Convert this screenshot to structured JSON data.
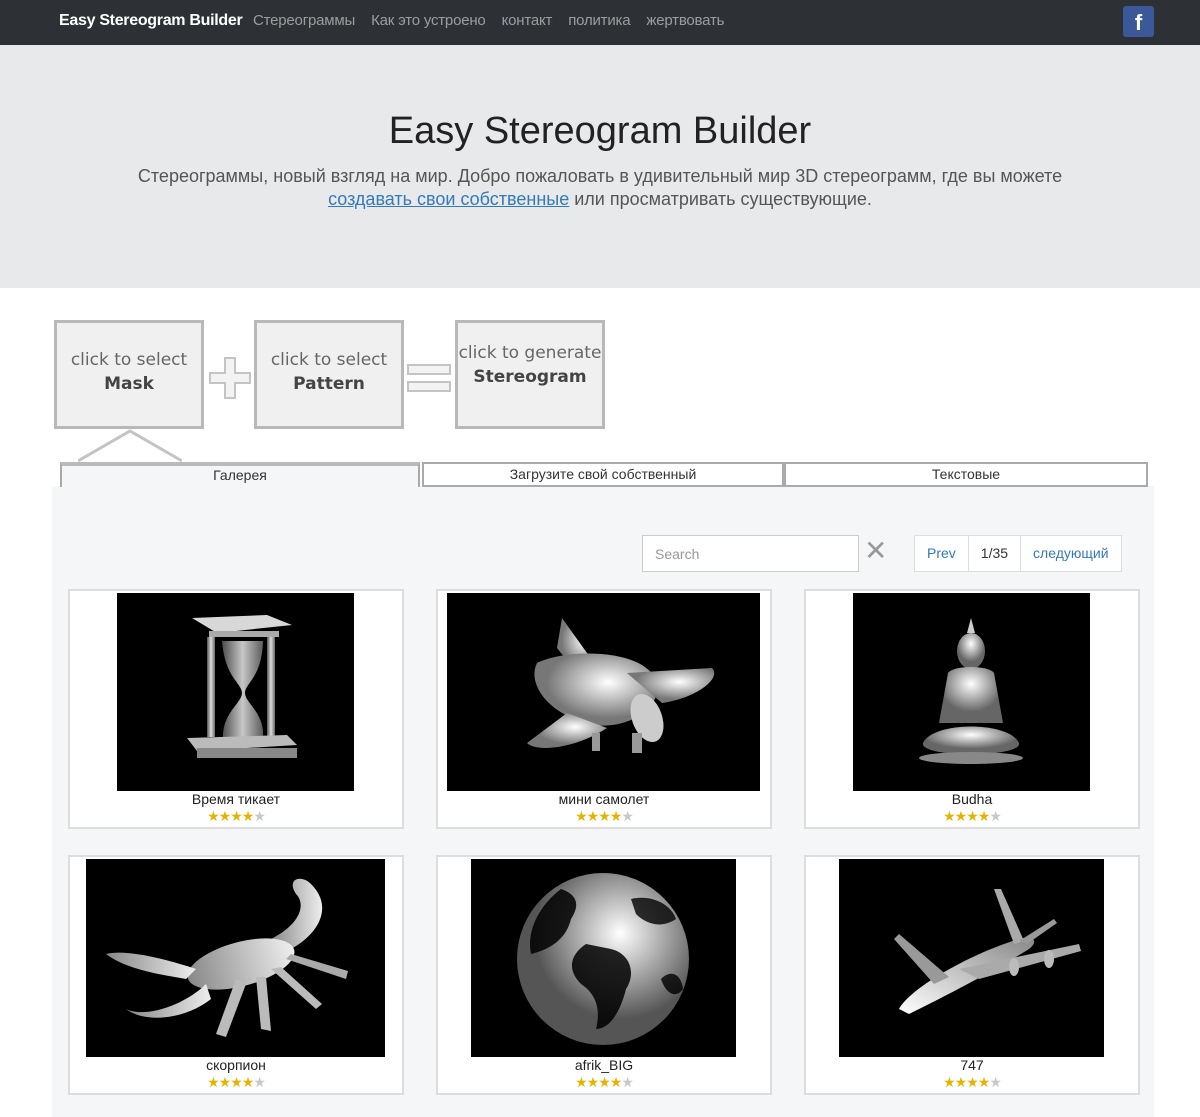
{
  "navbar": {
    "brand": "Easy Stereogram Builder",
    "links": [
      "Стереограммы",
      "Как это устроено",
      "контакт",
      "политика",
      "жертвовать"
    ],
    "social_icon": "facebook-icon",
    "social_glyph": "f"
  },
  "jumbotron": {
    "title": "Easy Stereogram Builder",
    "text_before": "Стереограммы, новый взгляд на мир. Добро пожаловать в удивительный мир 3D стереограмм, где вы можете",
    "link_text": "создавать свои собственные",
    "text_after": " или просматривать существующие."
  },
  "builder": {
    "mask": {
      "line1": "click to select",
      "line2": "Mask"
    },
    "pattern": {
      "line1": "click to select",
      "line2": "Pattern"
    },
    "generate": {
      "line1": "click to generate",
      "line2": "Stereogram"
    },
    "plus": "+",
    "equals": "="
  },
  "tabs": [
    "Галерея",
    "Загрузите свой собственный",
    "Текстовые"
  ],
  "gallery": {
    "search_placeholder": "Search",
    "clear_glyph": "✕",
    "prev_label": "Prev",
    "page_indicator": "1/35",
    "next_label": "следующий",
    "items": [
      {
        "name": "Время тикает",
        "rating": 4,
        "max_rating": 5,
        "icon": "hourglass-icon"
      },
      {
        "name": "мини самолет",
        "rating": 4,
        "max_rating": 5,
        "icon": "toy-plane-icon"
      },
      {
        "name": "Budha",
        "rating": 4,
        "max_rating": 5,
        "icon": "buddha-icon"
      },
      {
        "name": "скорпион",
        "rating": 4,
        "max_rating": 5,
        "icon": "scorpion-icon"
      },
      {
        "name": "afrik_BIG",
        "rating": 4,
        "max_rating": 5,
        "icon": "globe-icon"
      },
      {
        "name": "747",
        "rating": 4,
        "max_rating": 5,
        "icon": "airliner-icon"
      }
    ]
  },
  "colors": {
    "navbar_bg": "#2d3136",
    "jumbotron_bg": "#e8e9eb",
    "link": "#337ab7",
    "star_on": "#e8b300",
    "star_off": "#c8c8c8"
  }
}
